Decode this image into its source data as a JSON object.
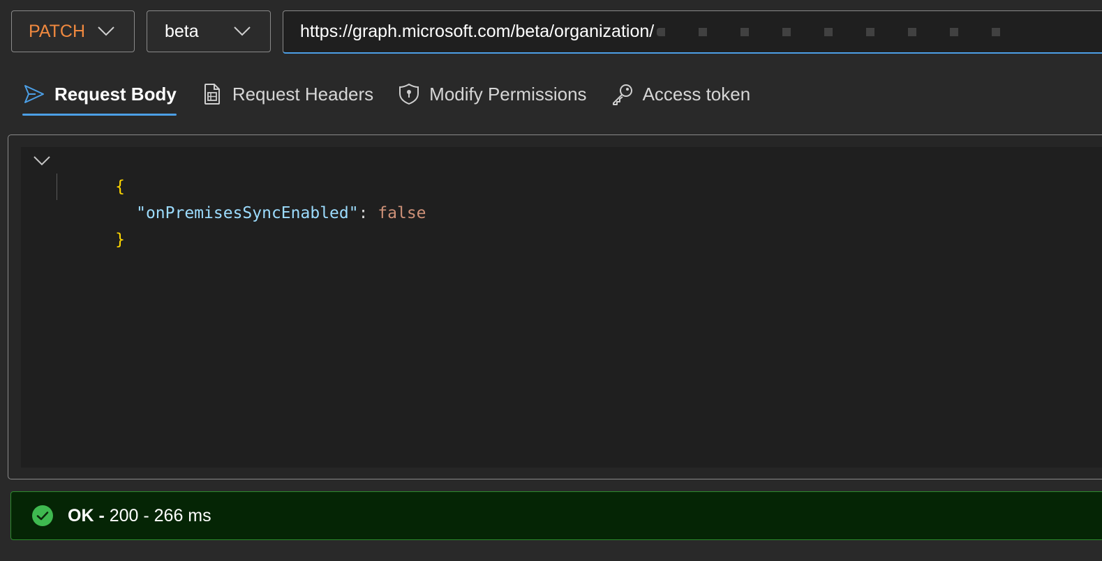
{
  "request": {
    "method": "PATCH",
    "version": "beta",
    "url": "https://graph.microsoft.com/beta/organization/"
  },
  "tabs": [
    {
      "label": "Request Body",
      "icon": "send-icon",
      "active": true
    },
    {
      "label": "Request Headers",
      "icon": "document-icon",
      "active": false
    },
    {
      "label": "Modify Permissions",
      "icon": "shield-lock-icon",
      "active": false
    },
    {
      "label": "Access token",
      "icon": "key-icon",
      "active": false
    }
  ],
  "editor": {
    "open_brace": "{",
    "key": "\"onPremisesSyncEnabled\"",
    "colon": ": ",
    "value": "false",
    "close_brace": "}"
  },
  "status": {
    "ok": "OK - ",
    "detail": "200 - 266 ms",
    "color": "#2d8a2d"
  },
  "colors": {
    "accent": "#4c9fe6",
    "method": "#f0893f",
    "json_brace": "#ffd700",
    "json_key": "#9cdcfe",
    "json_bool": "#ce9178"
  }
}
